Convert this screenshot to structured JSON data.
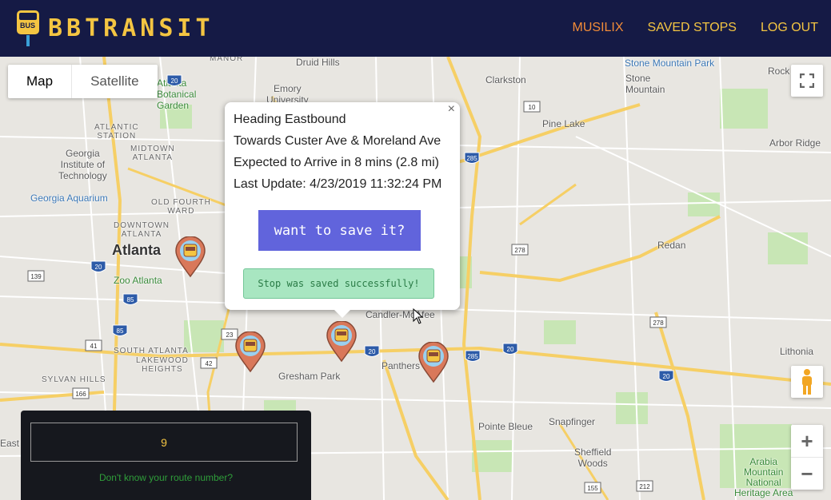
{
  "nav": {
    "brand_name": "BBTRANSIT",
    "logo_badge": "BUS",
    "links": [
      {
        "label": "MUSILIX",
        "color": "#f28c38"
      },
      {
        "label": "SAVED STOPS",
        "color": "#f4c542"
      },
      {
        "label": "LOG OUT",
        "color": "#f4c542"
      }
    ]
  },
  "map": {
    "type_control": {
      "map_label": "Map",
      "satellite_label": "Satellite"
    },
    "fullscreen_icon": "fullscreen-icon",
    "zoom_in_label": "+",
    "zoom_out_label": "−",
    "pegman_icon": "pegman-icon",
    "labels": {
      "atlanta": "Atlanta",
      "clarkston": "Clarkston",
      "stone_mountain_park": "Stone Mountain Park",
      "stone_mountain": "Stone\nMountain",
      "pine_lake": "Pine Lake",
      "arbor_ridge": "Arbor Ridge",
      "redan": "Redan",
      "lithonia": "Lithonia",
      "rock": "Rock",
      "druid_hills": "Druid Hills",
      "emory": "Emory\nUniversity",
      "atlanta_botanical": "Atlanta\nBotanical\nGarden",
      "georgia_tech": "Georgia\nInstitute of\nTechnology",
      "georgia_aquarium": "Georgia Aquarium",
      "zoo_atlanta": "Zoo Atlanta",
      "candler": "Candler-McAfee",
      "gresham_park": "Gresham Park",
      "panthersville": "Panthers",
      "pointe_bleue": "Pointe Bleue",
      "snapfinger": "Snapfinger",
      "sheffield_woods": "Sheffield\nWoods",
      "arabia": "Arabia\nMountain\nNational\nHeritage Area",
      "east": "East",
      "manor": "MANOR",
      "atlantic_station": "ATLANTIC\nSTATION",
      "midtown": "MIDTOWN\nATLANTA",
      "old_fourth_ward": "OLD FOURTH\nWARD",
      "downtown": "DOWNTOWN\nATLANTA",
      "south_atlanta": "SOUTH ATLANTA",
      "lakewood": "LAKEWOOD\nHEIGHTS",
      "sylvan": "SYLVAN HILLS"
    },
    "shields": [
      "285",
      "278",
      "20",
      "20",
      "20",
      "278",
      "285",
      "20",
      "10",
      "23",
      "85",
      "85",
      "41",
      "42",
      "139",
      "166",
      "155",
      "212",
      "20"
    ]
  },
  "popup": {
    "line1": "Heading Eastbound",
    "line2": "Towards Custer Ave & Moreland Ave",
    "line3": "Expected to Arrive in 8 mins (2.8 mi)",
    "line4": "Last Update: 4/23/2019 11:32:24 PM",
    "close_label": "×",
    "save_button_label": "want to save it?",
    "success_message": "Stop was saved successfully!"
  },
  "route_panel": {
    "route_value": "9",
    "help_link": "Don't know your route number?"
  },
  "colors": {
    "navbar": "#151a45",
    "accent_yellow": "#f4c542",
    "accent_orange": "#f28c38",
    "save_button": "#6164dc",
    "success_bg": "#a8e6c1",
    "marker": "#d9785a"
  }
}
